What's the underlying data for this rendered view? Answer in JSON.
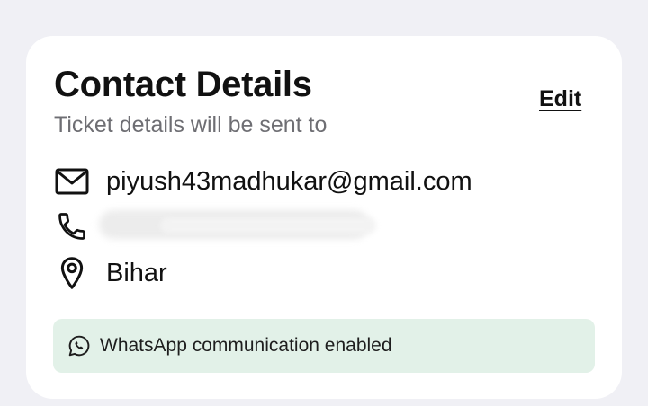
{
  "card": {
    "title": "Contact Details",
    "subtitle": "Ticket details will be sent to",
    "edit_label": "Edit"
  },
  "contact": {
    "email": {
      "icon": "mail-icon",
      "value": "piyush43madhukar@gmail.com"
    },
    "phone": {
      "icon": "phone-icon",
      "value": ""
    },
    "location": {
      "icon": "location-pin-icon",
      "value": "Bihar"
    }
  },
  "whatsapp": {
    "icon": "whatsapp-icon",
    "label": "WhatsApp communication enabled"
  },
  "colors": {
    "page_background": "#f0f0f5",
    "card_background": "#ffffff",
    "whatsapp_banner": "#e2f1e8",
    "text_primary": "#111111",
    "text_secondary": "#6e6e73"
  }
}
